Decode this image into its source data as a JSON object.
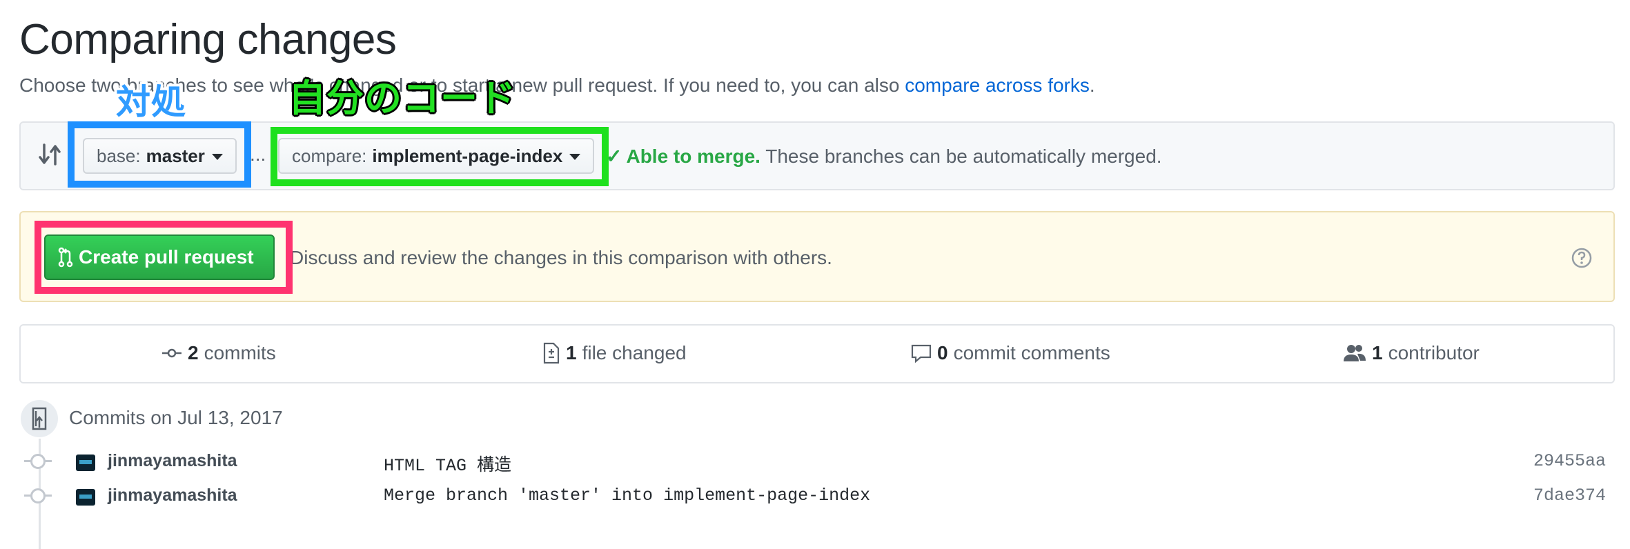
{
  "header": {
    "title": "Comparing changes",
    "subtitle_prefix": "Choose two branches to see what's changed or to start a new pull request. If you need to, you can also ",
    "subtitle_link": "compare across forks",
    "subtitle_suffix": "."
  },
  "range": {
    "base_label": "base:",
    "base_value": "master",
    "separator": "...",
    "compare_label": "compare:",
    "compare_value": "implement-page-index",
    "merge_status": "Able to merge.",
    "merge_detail": " These branches can be automatically merged."
  },
  "flash": {
    "create_button": "Create pull request",
    "text": "Discuss and review the changes in this comparison with others."
  },
  "stats": {
    "commits_count": "2",
    "commits_label": "commits",
    "files_count": "1",
    "files_label": "file changed",
    "comments_count": "0",
    "comments_label": "commit comments",
    "contributors_count": "1",
    "contributors_label": "contributor"
  },
  "commits": {
    "date_heading": "Commits on Jul 13, 2017",
    "items": [
      {
        "author": "jinmayamashita",
        "message": "HTML TAG 構造",
        "sha": "29455aa"
      },
      {
        "author": "jinmayamashita",
        "message": "Merge branch 'master' into implement-page-index",
        "sha": "7dae374"
      }
    ]
  },
  "annotations": {
    "base_label": "対処",
    "compare_label": "自分のコード",
    "colors": {
      "base": "#1e90ff",
      "compare": "#1ee01e",
      "create": "#ff3370"
    }
  },
  "icons": [
    "compare-arrows-icon",
    "caret-down-icon",
    "check-icon",
    "pull-request-icon",
    "question-icon",
    "commit-icon",
    "file-diff-icon",
    "comment-icon",
    "people-icon",
    "repo-push-icon"
  ]
}
